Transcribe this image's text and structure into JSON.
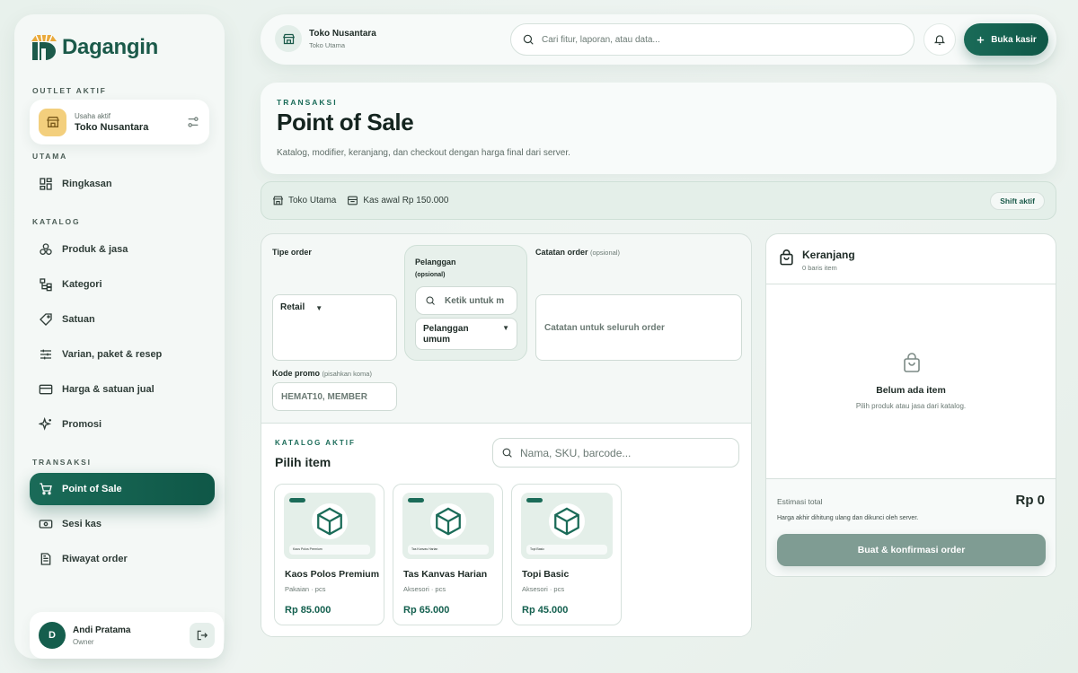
{
  "brand": {
    "name": "Dagangin"
  },
  "sidebar": {
    "outlet_section_label": "OUTLET AKTIF",
    "outlet": {
      "sub": "Usaha aktif",
      "name": "Toko Nusantara"
    },
    "sections": [
      {
        "label": "UTAMA"
      },
      {
        "label": "KATALOG"
      },
      {
        "label": "TRANSAKSI"
      }
    ],
    "items": [
      {
        "label": "Ringkasan",
        "icon": "grid-icon"
      },
      {
        "label": "Produk & jasa",
        "icon": "boxes-icon"
      },
      {
        "label": "Kategori",
        "icon": "hierarchy-icon"
      },
      {
        "label": "Satuan",
        "icon": "tag-icon"
      },
      {
        "label": "Varian, paket & resep",
        "icon": "sliders-icon"
      },
      {
        "label": "Harga & satuan jual",
        "icon": "card-icon"
      },
      {
        "label": "Promosi",
        "icon": "sparkle-icon"
      },
      {
        "label": "Point of Sale",
        "icon": "cart-icon",
        "active": true
      },
      {
        "label": "Sesi kas",
        "icon": "cash-icon"
      },
      {
        "label": "Riwayat order",
        "icon": "document-icon"
      }
    ],
    "user": {
      "initial": "D",
      "name": "Andi Pratama",
      "role": "Owner"
    }
  },
  "topbar": {
    "store_name": "Toko Nusantara",
    "store_sub": "Toko Utama",
    "search_placeholder": "Cari fitur, laporan, atau data...",
    "open_button": "Buka kasir"
  },
  "header": {
    "eyebrow": "TRANSAKSI",
    "title": "Point of Sale",
    "subtitle": "Katalog, modifier, keranjang, dan checkout dengan harga final dari server."
  },
  "shift": {
    "outlet": "Toko Utama",
    "cash": "Kas awal Rp 150.000",
    "badge": "Shift aktif"
  },
  "order": {
    "type_label": "Tipe order",
    "type_value": "Retail",
    "customer_label": "Pelanggan",
    "customer_optional": "(opsional)",
    "customer_search_placeholder": "Ketik untuk m",
    "customer_value": "Pelanggan umum",
    "note_label": "Catatan order",
    "note_optional": "(opsional)",
    "note_placeholder": "Catatan untuk seluruh order",
    "promo_label": "Kode promo",
    "promo_hint": "(pisahkan koma)",
    "promo_placeholder": "HEMAT10, MEMBER"
  },
  "catalog": {
    "eyebrow": "KATALOG AKTIF",
    "title": "Pilih item",
    "search_placeholder": "Nama, SKU, barcode...",
    "products": [
      {
        "name": "Kaos Polos Premium",
        "category": "Pakaian · pcs",
        "price": "Rp 85.000"
      },
      {
        "name": "Tas Kanvas Harian",
        "category": "Aksesori · pcs",
        "price": "Rp 65.000"
      },
      {
        "name": "Topi Basic",
        "category": "Aksesori · pcs",
        "price": "Rp 45.000"
      }
    ]
  },
  "cart": {
    "title": "Keranjang",
    "count": "0 baris item",
    "empty_title": "Belum ada item",
    "empty_sub": "Pilih produk atau jasa dari katalog.",
    "total_label": "Estimasi total",
    "total_value": "Rp 0",
    "note": "Harga akhir dihitung ulang dan dikunci oleh server.",
    "confirm_button": "Buat & konfirmasi order"
  },
  "colors": {
    "primary": "#155e4d",
    "accent": "#f3cf7d",
    "background": "#eef4f1"
  }
}
